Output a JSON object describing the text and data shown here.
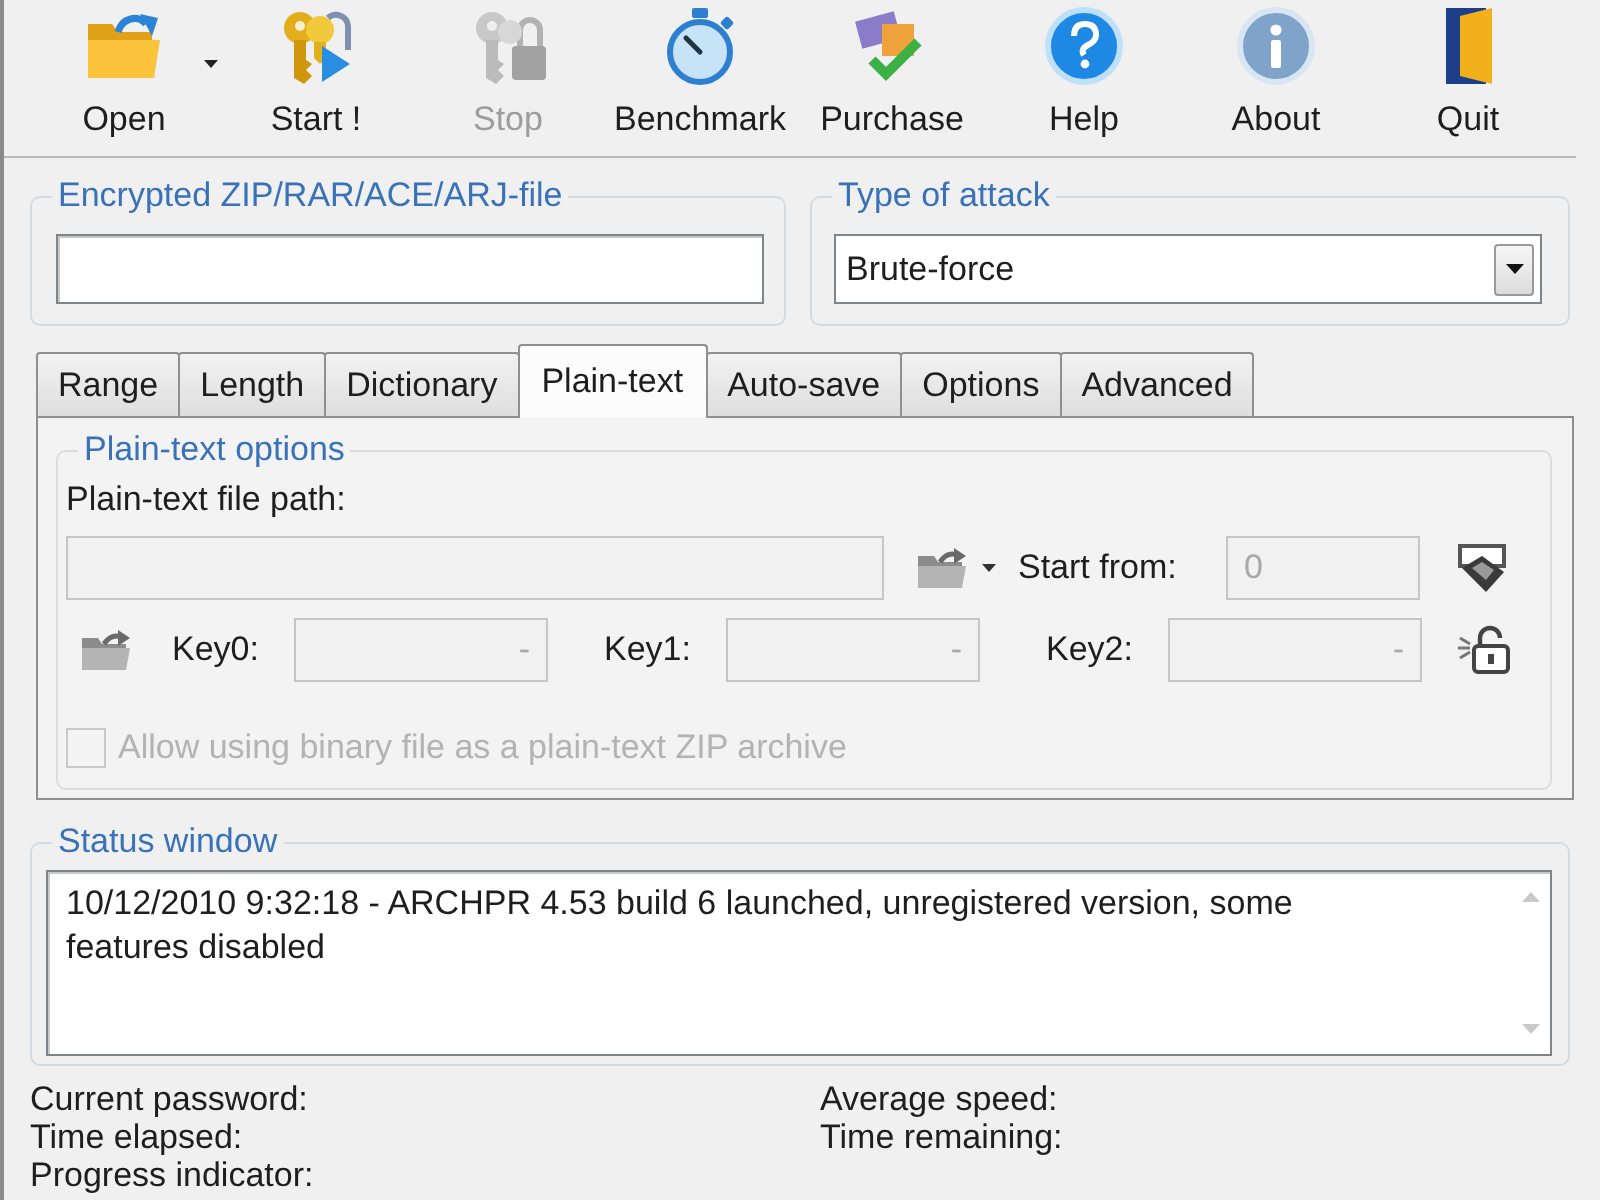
{
  "toolbar": [
    {
      "label": "Open",
      "disabled": false,
      "dropdown": true
    },
    {
      "label": "Start !",
      "disabled": false,
      "dropdown": false
    },
    {
      "label": "Stop",
      "disabled": true,
      "dropdown": false
    },
    {
      "label": "Benchmark",
      "disabled": false,
      "dropdown": false
    },
    {
      "label": "Purchase",
      "disabled": false,
      "dropdown": false
    },
    {
      "label": "Help",
      "disabled": false,
      "dropdown": false
    },
    {
      "label": "About",
      "disabled": false,
      "dropdown": false
    },
    {
      "label": "Quit",
      "disabled": false,
      "dropdown": false
    }
  ],
  "archive_file": {
    "title": "Encrypted ZIP/RAR/ACE/ARJ-file"
  },
  "attack_type": {
    "title": "Type of attack",
    "value": "Brute-force"
  },
  "tabs": [
    {
      "label": "Range",
      "selected": false
    },
    {
      "label": "Length",
      "selected": false
    },
    {
      "label": "Dictionary",
      "selected": false
    },
    {
      "label": "Plain-text",
      "selected": true
    },
    {
      "label": "Auto-save",
      "selected": false
    },
    {
      "label": "Options",
      "selected": false
    },
    {
      "label": "Advanced",
      "selected": false
    }
  ],
  "plain_text_options": {
    "title": "Plain-text options",
    "file_path": {
      "label": "Plain-text file path:",
      "disabled": true
    },
    "start_from": {
      "label": "Start from:",
      "value": "0",
      "disabled": true
    },
    "keys": [
      {
        "label": "Key0:",
        "value": "-",
        "disabled": true
      },
      {
        "label": "Key1:",
        "value": "-",
        "disabled": true
      },
      {
        "label": "Key2:",
        "value": "-",
        "disabled": true
      }
    ],
    "binary_option": {
      "label": "Allow using binary file as a plain-text ZIP archive",
      "checked": false,
      "disabled": true
    }
  },
  "status_window": {
    "title": "Status window",
    "text": "10/12/2010 9:32:18 - ARCHPR 4.53 build 6 launched, unregistered version, some features disabled"
  },
  "stats": [
    {
      "label": "Current password:"
    },
    {
      "label": "Average speed:"
    },
    {
      "label": "Time elapsed:"
    },
    {
      "label": "Time remaining:"
    },
    {
      "label": "Progress indicator:"
    }
  ]
}
